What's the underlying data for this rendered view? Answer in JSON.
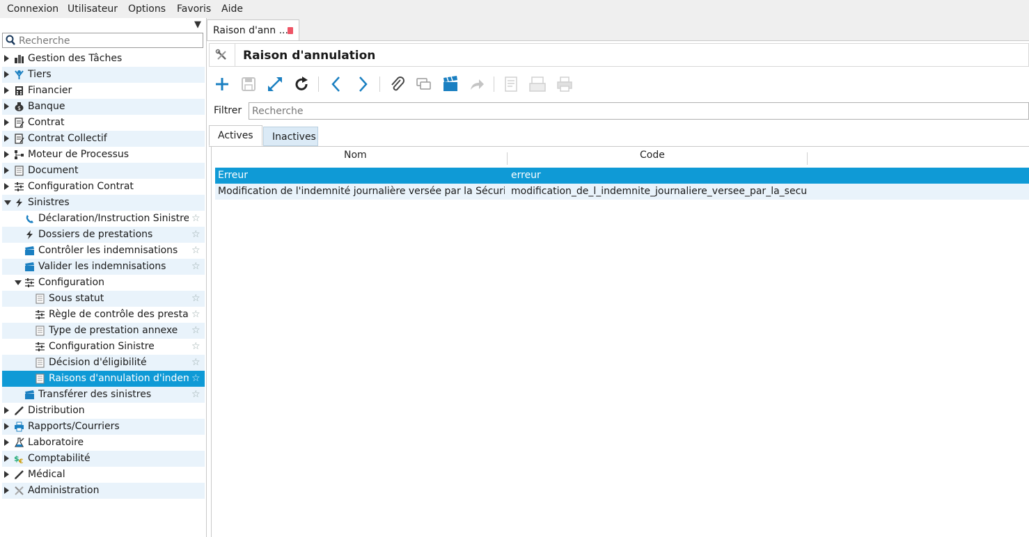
{
  "menu": [
    "Connexion",
    "Utilisateur",
    "Options",
    "Favoris",
    "Aide"
  ],
  "sidebar": {
    "search_placeholder": "Recherche",
    "items": [
      {
        "label": "Gestion des Tâches",
        "icon": "tasks-icon",
        "level": 0,
        "state": "collapsed"
      },
      {
        "label": "Tiers",
        "icon": "people-icon",
        "level": 0,
        "state": "collapsed"
      },
      {
        "label": "Financier",
        "icon": "calculator-icon",
        "level": 0,
        "state": "collapsed"
      },
      {
        "label": "Banque",
        "icon": "money-bag-icon",
        "level": 0,
        "state": "collapsed"
      },
      {
        "label": "Contrat",
        "icon": "contract-icon",
        "level": 0,
        "state": "collapsed"
      },
      {
        "label": "Contrat Collectif",
        "icon": "contract-icon",
        "level": 0,
        "state": "collapsed"
      },
      {
        "label": "Moteur de Processus",
        "icon": "process-icon",
        "level": 0,
        "state": "collapsed"
      },
      {
        "label": "Document",
        "icon": "document-icon",
        "level": 0,
        "state": "collapsed"
      },
      {
        "label": "Configuration Contrat",
        "icon": "sliders-icon",
        "level": 0,
        "state": "collapsed"
      },
      {
        "label": "Sinistres",
        "icon": "lightning-icon",
        "level": 0,
        "state": "expanded"
      },
      {
        "label": "Déclaration/Instruction Sinistres",
        "icon": "phone-icon",
        "level": 1,
        "state": "leaf",
        "star": true
      },
      {
        "label": "Dossiers de prestations",
        "icon": "lightning-icon",
        "level": 1,
        "state": "leaf",
        "star": true
      },
      {
        "label": "Contrôler les indemnisations",
        "icon": "clapper-icon",
        "level": 1,
        "state": "leaf",
        "star": true
      },
      {
        "label": "Valider les indemnisations",
        "icon": "clapper-icon",
        "level": 1,
        "state": "leaf",
        "star": true
      },
      {
        "label": "Configuration",
        "icon": "sliders-icon",
        "level": 1,
        "state": "expanded"
      },
      {
        "label": "Sous statut",
        "icon": "list-icon",
        "level": 2,
        "state": "leaf",
        "star": true
      },
      {
        "label": "Règle de contrôle des prestati",
        "icon": "sliders-icon",
        "level": 2,
        "state": "leaf",
        "star": true
      },
      {
        "label": "Type de prestation annexe",
        "icon": "list-icon",
        "level": 2,
        "state": "leaf",
        "star": true
      },
      {
        "label": "Configuration Sinistre",
        "icon": "sliders-icon",
        "level": 2,
        "state": "leaf",
        "star": true
      },
      {
        "label": "Décision d'éligibilité",
        "icon": "list-icon",
        "level": 2,
        "state": "leaf",
        "star": true
      },
      {
        "label": "Raisons d'annulation d'indemn",
        "icon": "list-icon",
        "level": 2,
        "state": "leaf",
        "star": true,
        "selected": true
      },
      {
        "label": "Transférer des sinistres",
        "icon": "clapper-icon",
        "level": 1,
        "state": "leaf",
        "star": true
      },
      {
        "label": "Distribution",
        "icon": "pencil-icon",
        "level": 0,
        "state": "collapsed"
      },
      {
        "label": "Rapports/Courriers",
        "icon": "printer-icon",
        "level": 0,
        "state": "collapsed"
      },
      {
        "label": "Laboratoire",
        "icon": "flask-icon",
        "level": 0,
        "state": "collapsed"
      },
      {
        "label": "Comptabilité",
        "icon": "currency-icon",
        "level": 0,
        "state": "collapsed"
      },
      {
        "label": "Médical",
        "icon": "pencil-icon",
        "level": 0,
        "state": "collapsed"
      },
      {
        "label": "Administration",
        "icon": "tools-icon",
        "level": 0,
        "state": "collapsed"
      }
    ]
  },
  "tab": {
    "label": "Raison d'ann ..."
  },
  "header": {
    "title": "Raison d'annulation"
  },
  "toolbar": [
    {
      "name": "add-icon",
      "enabled": true
    },
    {
      "name": "save-icon",
      "enabled": false
    },
    {
      "name": "expand-icon",
      "enabled": true
    },
    {
      "name": "refresh-icon",
      "enabled": true
    },
    {
      "name": "previous-icon",
      "enabled": true
    },
    {
      "name": "next-icon",
      "enabled": true
    },
    {
      "name": "attachment-icon",
      "enabled": true
    },
    {
      "name": "comments-icon",
      "enabled": true
    },
    {
      "name": "action-icon",
      "enabled": true
    },
    {
      "name": "forward-icon",
      "enabled": false
    },
    {
      "name": "report-icon",
      "enabled": false
    },
    {
      "name": "email-icon",
      "enabled": false
    },
    {
      "name": "print-icon",
      "enabled": false
    }
  ],
  "filter": {
    "label": "Filtrer",
    "placeholder": "Recherche"
  },
  "subtabs": {
    "active": "Actives",
    "inactive": "Inactives"
  },
  "grid": {
    "columns": [
      "Nom",
      "Code"
    ],
    "rows": [
      {
        "nom": "Erreur",
        "code": "erreur",
        "selected": true
      },
      {
        "nom": "Modification de l'indemnité journalière versée par la Sécurité S",
        "code": "modification_de_l_indemnite_journaliere_versee_par_la_securit",
        "selected": false
      }
    ]
  },
  "colors": {
    "selection": "#0f9ad6",
    "alt_row": "#e9f3fb",
    "accent": "#1a7fc1"
  }
}
